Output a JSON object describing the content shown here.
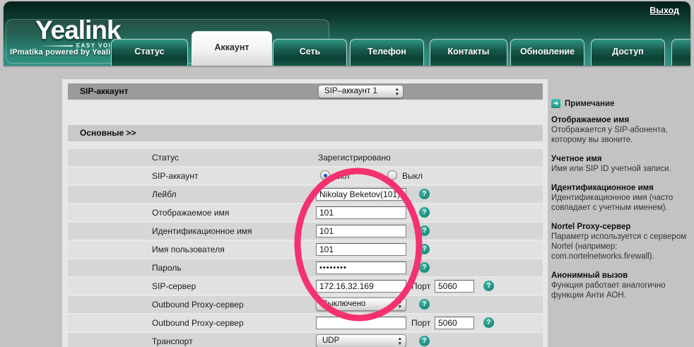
{
  "header": {
    "logo": {
      "brand": "Yealink",
      "tagline": "EASY VOIP",
      "subtitle": "IPmatika powered by Yealink"
    },
    "logout_label": "Выход",
    "tabs": [
      {
        "label": "Статус",
        "active": false
      },
      {
        "label": "Аккаунт",
        "active": true
      },
      {
        "label": "Сеть",
        "active": false
      },
      {
        "label": "Телефон",
        "active": false
      },
      {
        "label": "Контакты",
        "active": false
      },
      {
        "label": "Обновление",
        "active": false
      },
      {
        "label": "Доступ",
        "active": false
      }
    ]
  },
  "account_section": {
    "title": "SIP-аккаунт",
    "account_select_value": "SIP–аккаунт 1",
    "group_title": "Основные >>"
  },
  "form": {
    "port_label": "Порт",
    "rows": [
      {
        "label": "Статус",
        "value": "Зарегистрировано"
      },
      {
        "label": "SIP-аккаунт",
        "on_label": "Вкл",
        "off_label": "Выкл",
        "selected": "Вкл"
      },
      {
        "label": "Лейбл",
        "value": "Nikolay Beketov(101)"
      },
      {
        "label": "Отображаемое имя",
        "value": "101"
      },
      {
        "label": "Идентификационное имя",
        "value": "101"
      },
      {
        "label": "Имя пользователя",
        "value": "101"
      },
      {
        "label": "Пароль",
        "value": "••••••••"
      },
      {
        "label": "SIP-сервер",
        "value": "172.16.32.169",
        "port": "5060"
      },
      {
        "label": "Outbound Proxy-сервер",
        "value": "Выключено"
      },
      {
        "label": "Outbound Proxy-сервер",
        "value": "",
        "port": "5060"
      },
      {
        "label": "Транспорт",
        "value": "UDP"
      }
    ]
  },
  "sidebar": {
    "title": "Примечание",
    "notes": [
      {
        "title": "Отображаемое имя",
        "body": "Отображается у SIP-абонента, которому вы звоните."
      },
      {
        "title": "Учетное имя",
        "body": "Имя или SIP ID учетной записи."
      },
      {
        "title": "Идентификационное имя",
        "body": "Идентификационное имя (часто совпадает с учетным именем)."
      },
      {
        "title": "Nortel Proxy-сервер",
        "body": "Параметр используется с сервером Nortel (например: com.nortelnetworks.firewall)."
      },
      {
        "title": "Анонимный вызов",
        "body": "Функция работает аналогично функции Анти АОН."
      }
    ]
  },
  "annotation": {
    "shape": "hand-drawn-ellipse",
    "color": "#f5316f"
  },
  "icons": {
    "help": "?",
    "note_arrow": "➜",
    "select_up": "▲",
    "select_down": "▼"
  },
  "colors": {
    "accent_teal": "#2f9383",
    "help_icon": "#1b8c7e",
    "annotation_pink": "#f5316f"
  }
}
